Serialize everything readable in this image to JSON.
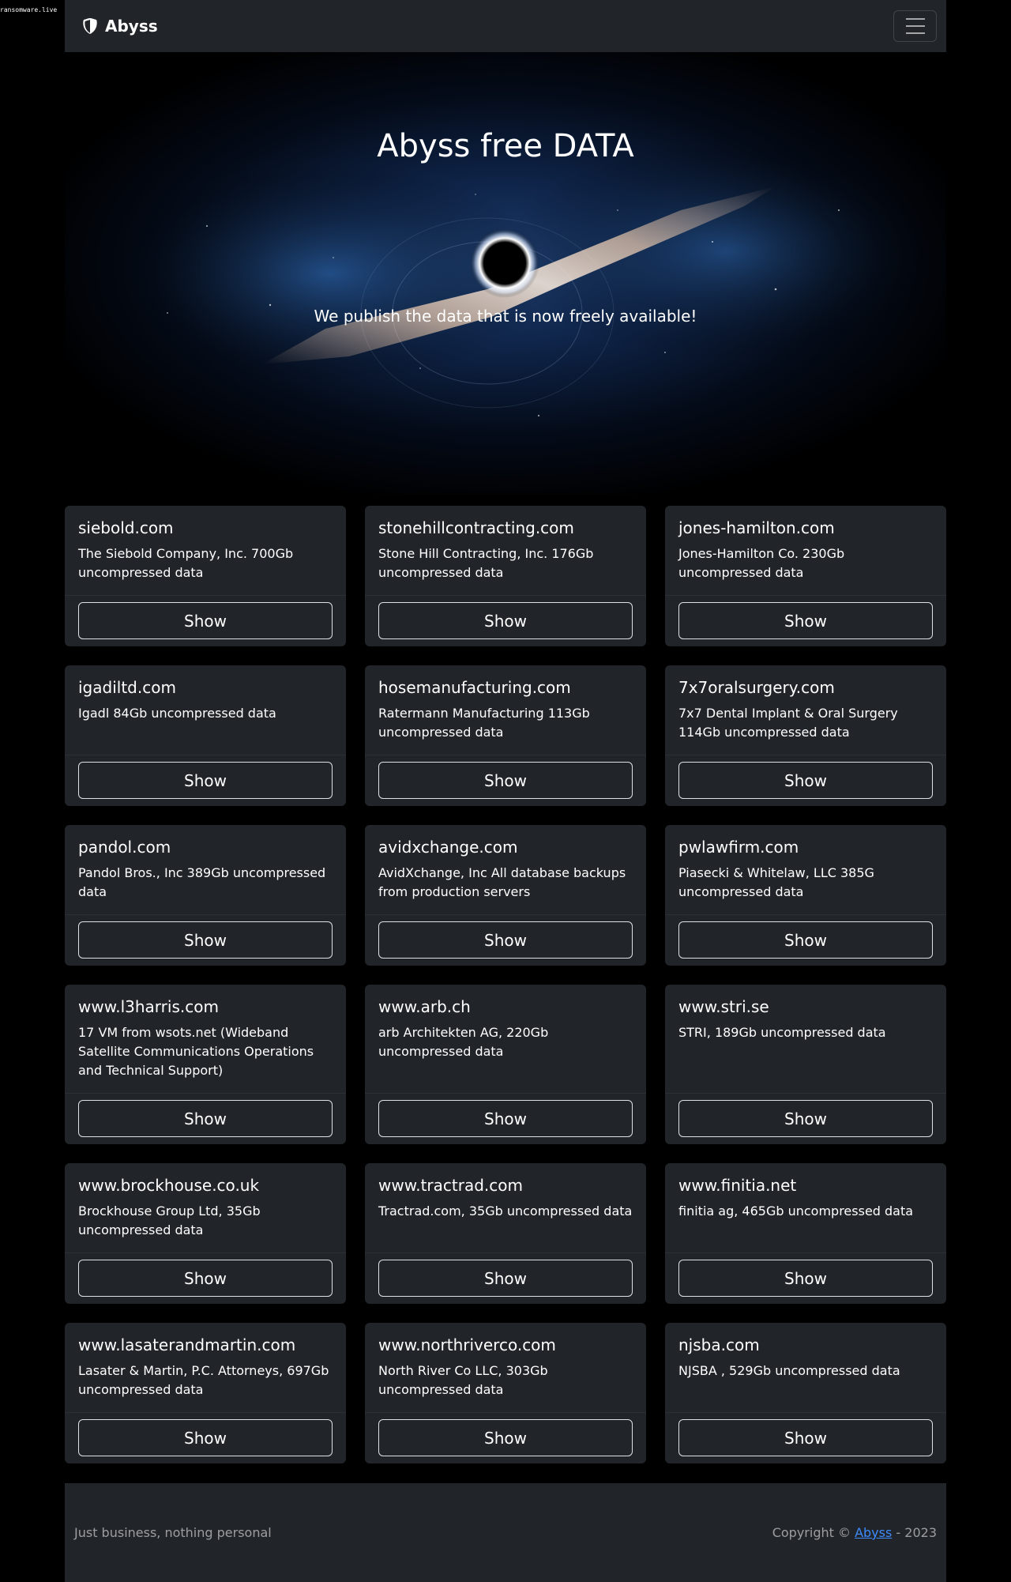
{
  "watermark": "ransomware.live",
  "navbar": {
    "brand": "Abyss",
    "brand_icon": "shield-half-icon",
    "toggler_icon": "hamburger-menu-icon"
  },
  "hero": {
    "title": "Abyss free DATA",
    "subtitle": "We publish the data that is now freely available!"
  },
  "cards": [
    {
      "title": "siebold.com",
      "text": "The Siebold Company, Inc. 700Gb uncompressed data",
      "button": "Show"
    },
    {
      "title": "stonehillcontracting.com",
      "text": "Stone Hill Contracting, Inc. 176Gb uncompressed data",
      "button": "Show"
    },
    {
      "title": "jones-hamilton.com",
      "text": "Jones-Hamilton Co. 230Gb uncompressed data",
      "button": "Show"
    },
    {
      "title": "igadiltd.com",
      "text": "Igadl 84Gb uncompressed data",
      "button": "Show"
    },
    {
      "title": "hosemanufacturing.com",
      "text": "Ratermann Manufacturing 113Gb uncompressed data",
      "button": "Show"
    },
    {
      "title": "7x7oralsurgery.com",
      "text": "7x7 Dental Implant & Oral Surgery 114Gb uncompressed data",
      "button": "Show"
    },
    {
      "title": "pandol.com",
      "text": "Pandol Bros., Inc 389Gb uncompressed data",
      "button": "Show"
    },
    {
      "title": "avidxchange.com",
      "text": "AvidXchange, Inc All database backups from production servers",
      "button": "Show"
    },
    {
      "title": "pwlawfirm.com",
      "text": "Piasecki & Whitelaw, LLC 385G uncompressed data",
      "button": "Show"
    },
    {
      "title": "www.l3harris.com",
      "text": "17 VM from wsots.net (Wideband Satellite Communications Operations and Technical Support)",
      "button": "Show"
    },
    {
      "title": "www.arb.ch",
      "text": "arb Architekten AG, 220Gb uncompressed data",
      "button": "Show"
    },
    {
      "title": "www.stri.se",
      "text": "STRI, 189Gb uncompressed data",
      "button": "Show"
    },
    {
      "title": "www.brockhouse.co.uk",
      "text": "Brockhouse Group Ltd, 35Gb uncompressed data",
      "button": "Show"
    },
    {
      "title": "www.tractrad.com",
      "text": "Tractrad.com, 35Gb uncompressed data",
      "button": "Show"
    },
    {
      "title": "www.finitia.net",
      "text": "finitia ag, 465Gb uncompressed data",
      "button": "Show"
    },
    {
      "title": "www.lasaterandmartin.com",
      "text": "Lasater & Martin, P.C. Attorneys, 697Gb uncompressed data",
      "button": "Show"
    },
    {
      "title": "www.northriverco.com",
      "text": "North River Co LLC, 303Gb uncompressed data",
      "button": "Show"
    },
    {
      "title": "njsba.com",
      "text": "NJSBA , 529Gb uncompressed data",
      "button": "Show"
    }
  ],
  "footer": {
    "tagline": "Just business, nothing personal",
    "copyright_prefix": "Copyright ©",
    "copyright_link": "Abyss",
    "copyright_suffix": "- 2023"
  }
}
